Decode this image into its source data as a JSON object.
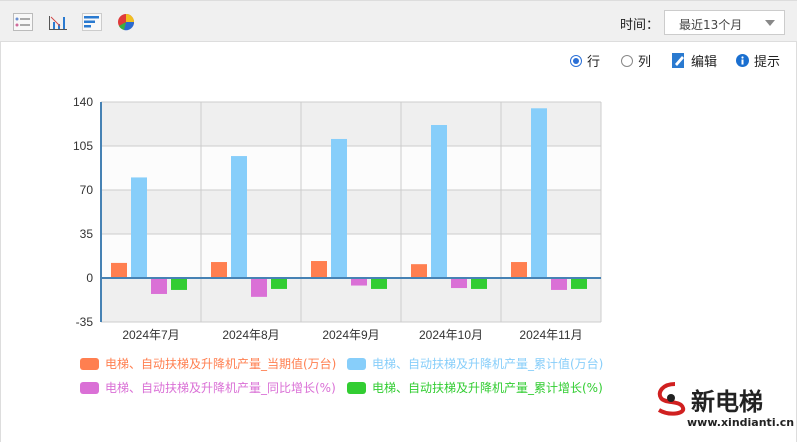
{
  "toolbar": {
    "icons": [
      "list-icon",
      "bar-line-chart-icon",
      "horizontal-bar-icon",
      "pie-chart-icon"
    ],
    "time_label": "时间：",
    "time_select": "最近13个月"
  },
  "options": {
    "row": "行",
    "col": "列",
    "edit": "编辑",
    "tip": "提示",
    "selected": "行"
  },
  "chart_data": {
    "type": "bar",
    "categories": [
      "2024年7月",
      "2024年8月",
      "2024年9月",
      "2024年10月",
      "2024年11月"
    ],
    "ylim": [
      -35,
      140
    ],
    "yticks": [
      "140",
      "105",
      "70",
      "35",
      "0",
      "-35"
    ],
    "grid": true,
    "legend_placement": "bottom",
    "series": [
      {
        "name": "电梯、自动扶梯及升降机产量_当期值(万台)",
        "color": "#ff7f50",
        "values": [
          12,
          12.7,
          13.5,
          11,
          12.7
        ]
      },
      {
        "name": "电梯、自动扶梯及升降机产量_累计值(万台)",
        "color": "#87cefa",
        "values": [
          80,
          97,
          110.6,
          121.7,
          135
        ]
      },
      {
        "name": "电梯、自动扶梯及升降机产量_同比增长(%)",
        "color": "#da70d6",
        "values": [
          -12.7,
          -15,
          -6,
          -8,
          -9.5
        ]
      },
      {
        "name": "电梯、自动扶梯及升降机产量_累计增长(%)",
        "color": "#32cd32",
        "values": [
          -9.5,
          -8.7,
          -8.7,
          -8.7,
          -8.7
        ]
      }
    ]
  },
  "watermark": {
    "name": "新电梯",
    "url": "www.xindianti.cn"
  }
}
